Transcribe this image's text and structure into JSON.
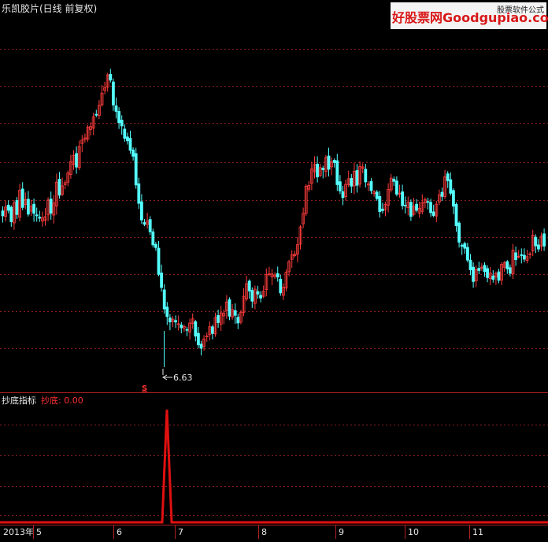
{
  "main_panel": {
    "title": "乐凯胶片(日线 前复权)",
    "low_label": "6.63",
    "signal_marker": "S"
  },
  "indicator_panel": {
    "name": "抄底指标",
    "series_label": "抄底: 0.00"
  },
  "watermark": {
    "site": "好股票网Goodgupiao.com",
    "tagline": "股票软件公式"
  },
  "time_axis": {
    "labels": [
      "2013年",
      "5",
      "6",
      "7",
      "8",
      "9",
      "10",
      "11"
    ]
  },
  "colors": {
    "background": "#000000",
    "up_candle": "#ff3c3c",
    "down_candle": "#54ffff",
    "grid": "#8c1e1e",
    "indicator": "#e01010"
  },
  "chart_data": [
    {
      "type": "candlestick",
      "title": "乐凯胶片(日线 前复权)",
      "annotations": [
        {
          "text": "6.63",
          "meaning": "period low"
        }
      ],
      "markers": [
        "S"
      ],
      "grid": true,
      "visible_low": 6.63,
      "estimated_ylim": [
        6.2,
        9.3
      ],
      "close_trend": [
        7.9,
        7.7,
        8.0,
        8.4,
        8.9,
        8.4,
        7.7,
        7.3,
        6.9,
        7.1,
        7.2,
        7.2,
        7.6,
        8.0,
        7.9,
        7.8,
        8.1,
        7.9,
        7.7,
        7.9,
        7.7,
        7.4,
        7.3,
        7.3,
        7.6
      ]
    },
    {
      "type": "line",
      "series": [
        {
          "name": "抄底",
          "values": [
            0,
            0,
            0,
            1,
            0,
            0,
            0,
            0
          ]
        }
      ],
      "current_value": 0.0
    }
  ]
}
